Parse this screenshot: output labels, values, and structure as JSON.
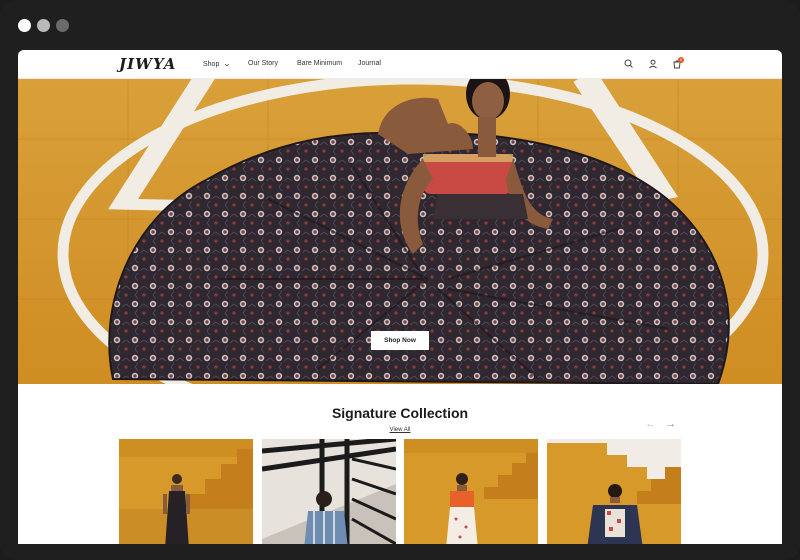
{
  "window": {
    "controls": [
      "close",
      "minimize",
      "maximize"
    ]
  },
  "header": {
    "logo": "JIWYA",
    "nav": [
      {
        "label": "Shop",
        "has_dropdown": true
      },
      {
        "label": "Our Story"
      },
      {
        "label": "Bare Minimum"
      },
      {
        "label": "Journal"
      }
    ],
    "icons": [
      "search-icon",
      "user-icon",
      "cart-icon"
    ],
    "cart_count": "0"
  },
  "hero": {
    "button_label": "Shop Now"
  },
  "collection": {
    "title": "Signature Collection",
    "view_all": "View All",
    "prev_arrow": "←",
    "next_arrow": "→",
    "products": [
      "product-1",
      "product-2",
      "product-3",
      "product-4"
    ]
  },
  "colors": {
    "mustard": "#d79a2a",
    "fabric_dark": "#2f2830",
    "accent_red": "#e25a2b",
    "ink": "#1a1a1a"
  }
}
